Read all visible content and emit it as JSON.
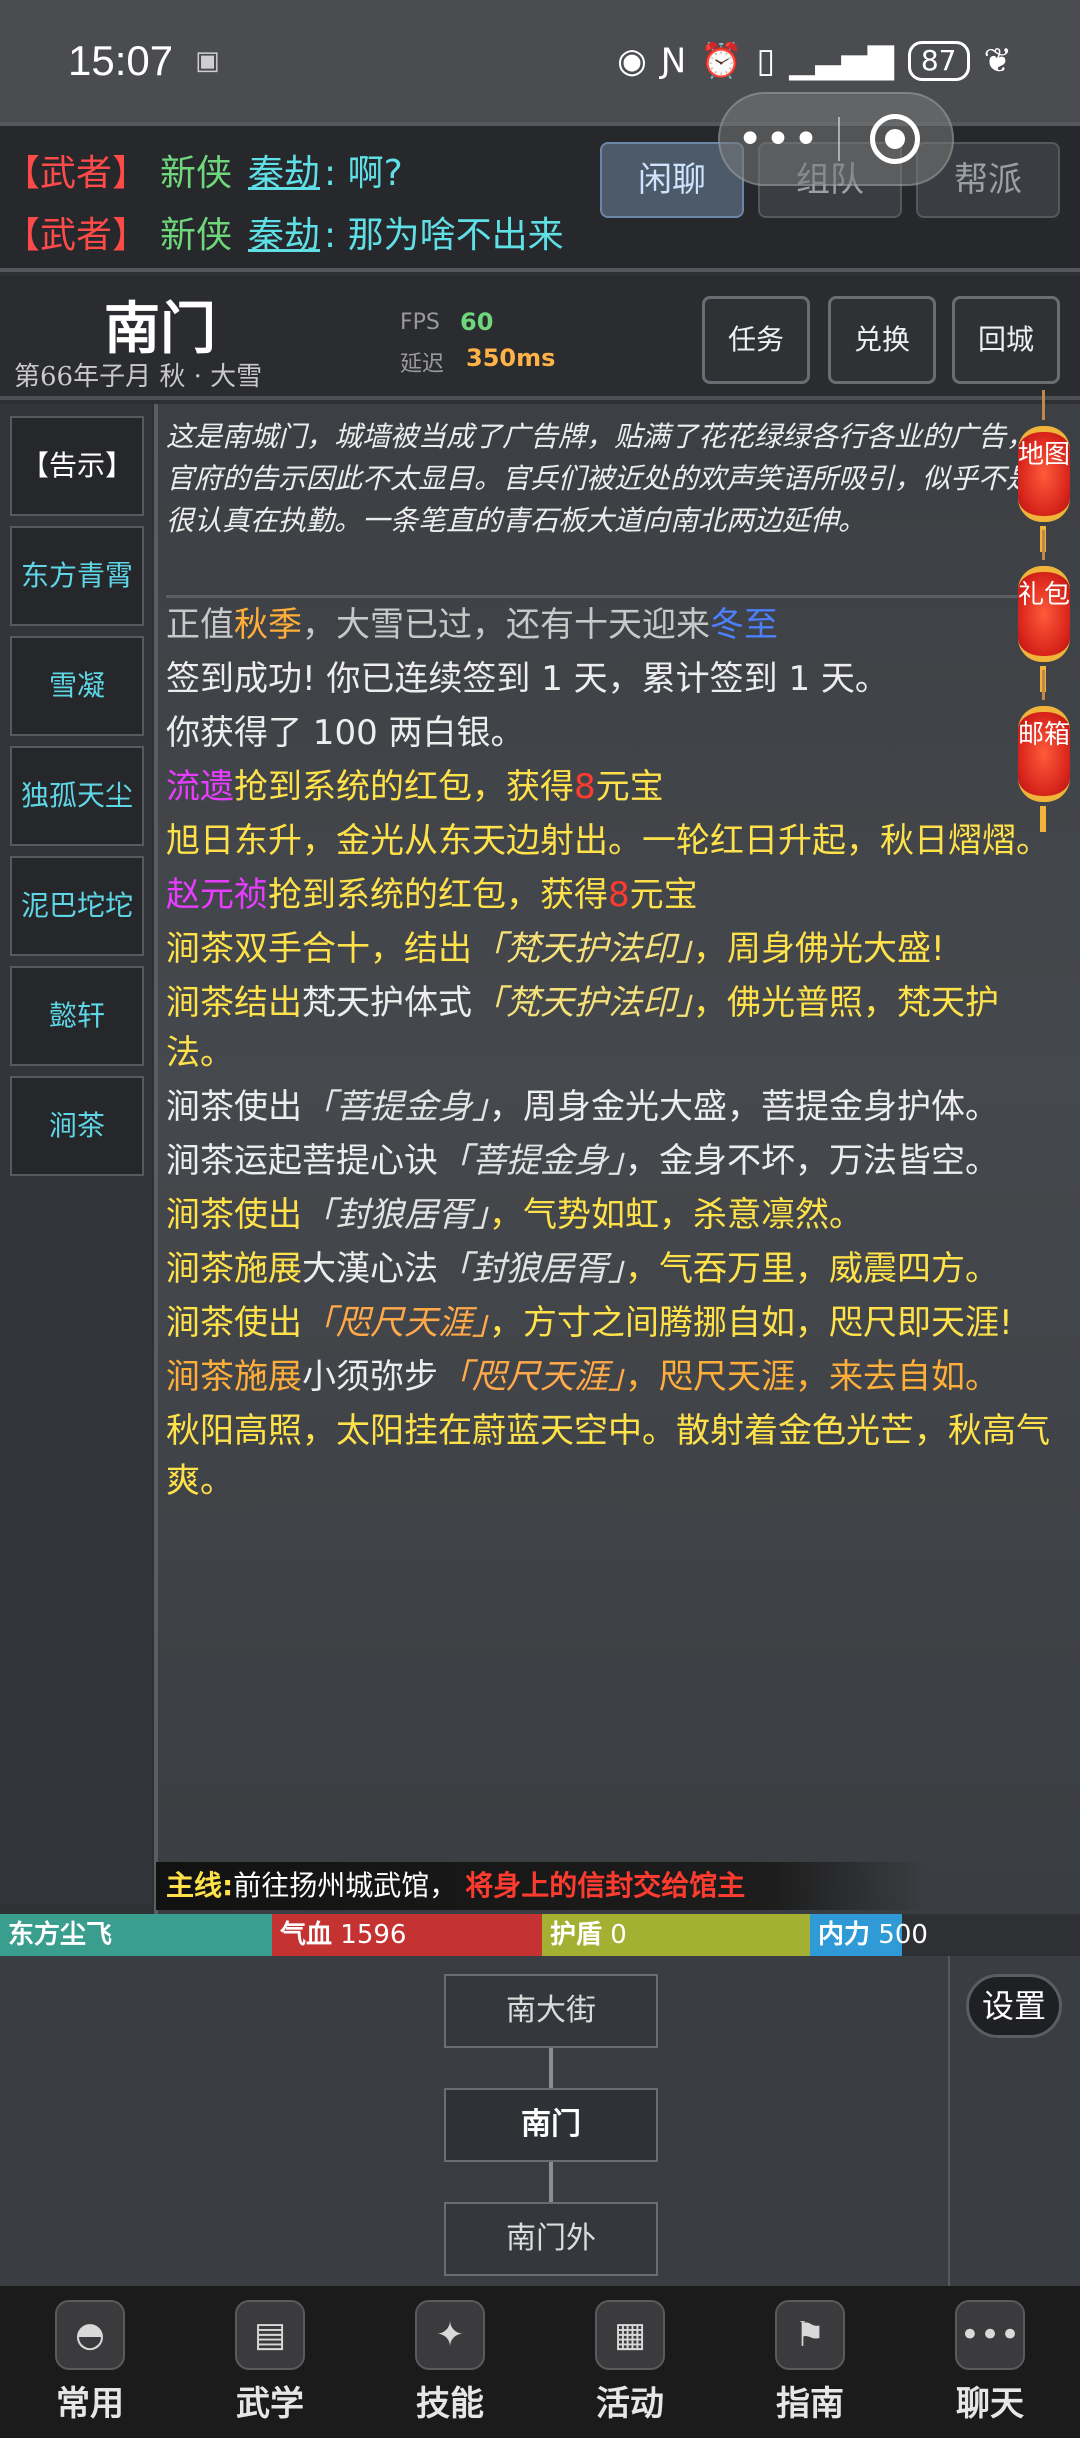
{
  "statusbar": {
    "time": "15:07",
    "battery": "87"
  },
  "chat": {
    "lines": [
      {
        "tag": "【武者】",
        "rank": "新侠",
        "who": "秦劫",
        "msg": ": 啊?"
      },
      {
        "tag": "【武者】",
        "rank": "新侠",
        "who": "秦劫",
        "msg": ": 那为啥不出来"
      }
    ],
    "tabs": [
      "闲聊",
      "组队",
      "帮派"
    ]
  },
  "location": {
    "name": "南门",
    "date": "第66年子月 秋 · 大雪",
    "fps_label": "FPS",
    "fps": "60",
    "latency_label": "延迟",
    "latency": "350ms",
    "buttons": [
      "任务",
      "兑换",
      "回城"
    ]
  },
  "npcs": [
    "【告示】",
    "东方青霄",
    "雪凝",
    "独孤天尘",
    "泥巴坨坨",
    "懿轩",
    "涧茶"
  ],
  "description": [
    "这是南城门，城墙被当成了广告牌，贴满了花花绿绿各行各业的广告，",
    "官府的告示因此不太显目。官兵们被近处的欢声笑语所吸引，似乎不是很认真在执勤。一条笔直的青石板大道向南北两边延伸。"
  ],
  "log": {
    "season": {
      "pre": "正值",
      "season": "秋季",
      "mid": "，大雪已过，还有十天迎来",
      "next": "冬至"
    },
    "signin": "签到成功! 你已连续签到 1 天，累计签到 1 天。",
    "silver": "你获得了 100 两白银。",
    "redpack1": {
      "name": "流遗",
      "text": "抢到系统的红包，获得",
      "amount": "8",
      "unit": "元宝"
    },
    "sunrise": "旭日东升，金光从东天边射出。一轮红日升起，秋日熠熠。",
    "redpack2": {
      "name": "赵元祯",
      "text": "抢到系统的红包，获得",
      "amount": "8",
      "unit": "元宝"
    },
    "e1": {
      "a": "涧茶双手合十，结出",
      "sk": "「梵天护法印」",
      "b": "，周身佛光大盛!"
    },
    "e2": {
      "a": "涧茶结出",
      "w": "梵天护体式",
      "sk": "「梵天护法印」",
      "b": "，佛光普照，梵天护法。"
    },
    "e3": {
      "a": "涧茶使出",
      "sk": "「菩提金身」",
      "b": "，周身金光大盛，菩提金身护体。"
    },
    "e4": {
      "a": "涧茶运起菩提心诀",
      "sk": "「菩提金身」",
      "b": "，金身不坏，万法皆空。"
    },
    "e5": {
      "a": "涧茶使出",
      "sk": "「封狼居胥」",
      "b": "，气势如虹，杀意凛然。"
    },
    "e6": {
      "a": "涧茶施展",
      "w": "大漢心法",
      "sk": "「封狼居胥」",
      "b": "，气吞万里，威震四方。"
    },
    "e7": {
      "a": "涧茶使出",
      "sk": "「咫尺天涯」",
      "b": "，方寸之间腾挪自如，咫尺即天涯!"
    },
    "e8": {
      "a": "涧茶施展",
      "w": "小须弥步",
      "sk": "「咫尺天涯」",
      "b": "，咫尺天涯，来去自如。"
    },
    "noon": "秋阳高照，太阳挂在蔚蓝天空中。散射着金色光芒，秋高气爽。"
  },
  "lanterns": [
    "地图",
    "礼包",
    "邮箱"
  ],
  "quest": {
    "label": "主线:",
    "text": "前往扬州城武馆，",
    "highlight": "将身上的信封交给馆主"
  },
  "bars": {
    "name": "东方尘飞",
    "hp_label": "气血",
    "hp": "1596",
    "shield_label": "护盾",
    "shield": "0",
    "mp_label": "内力",
    "mp": "500",
    "mp_fill": 0.34
  },
  "map": {
    "north": "南大街",
    "current": "南门",
    "south": "南门外",
    "settings": "设置"
  },
  "nav": [
    "常用",
    "武学",
    "技能",
    "活动",
    "指南",
    "聊天"
  ]
}
